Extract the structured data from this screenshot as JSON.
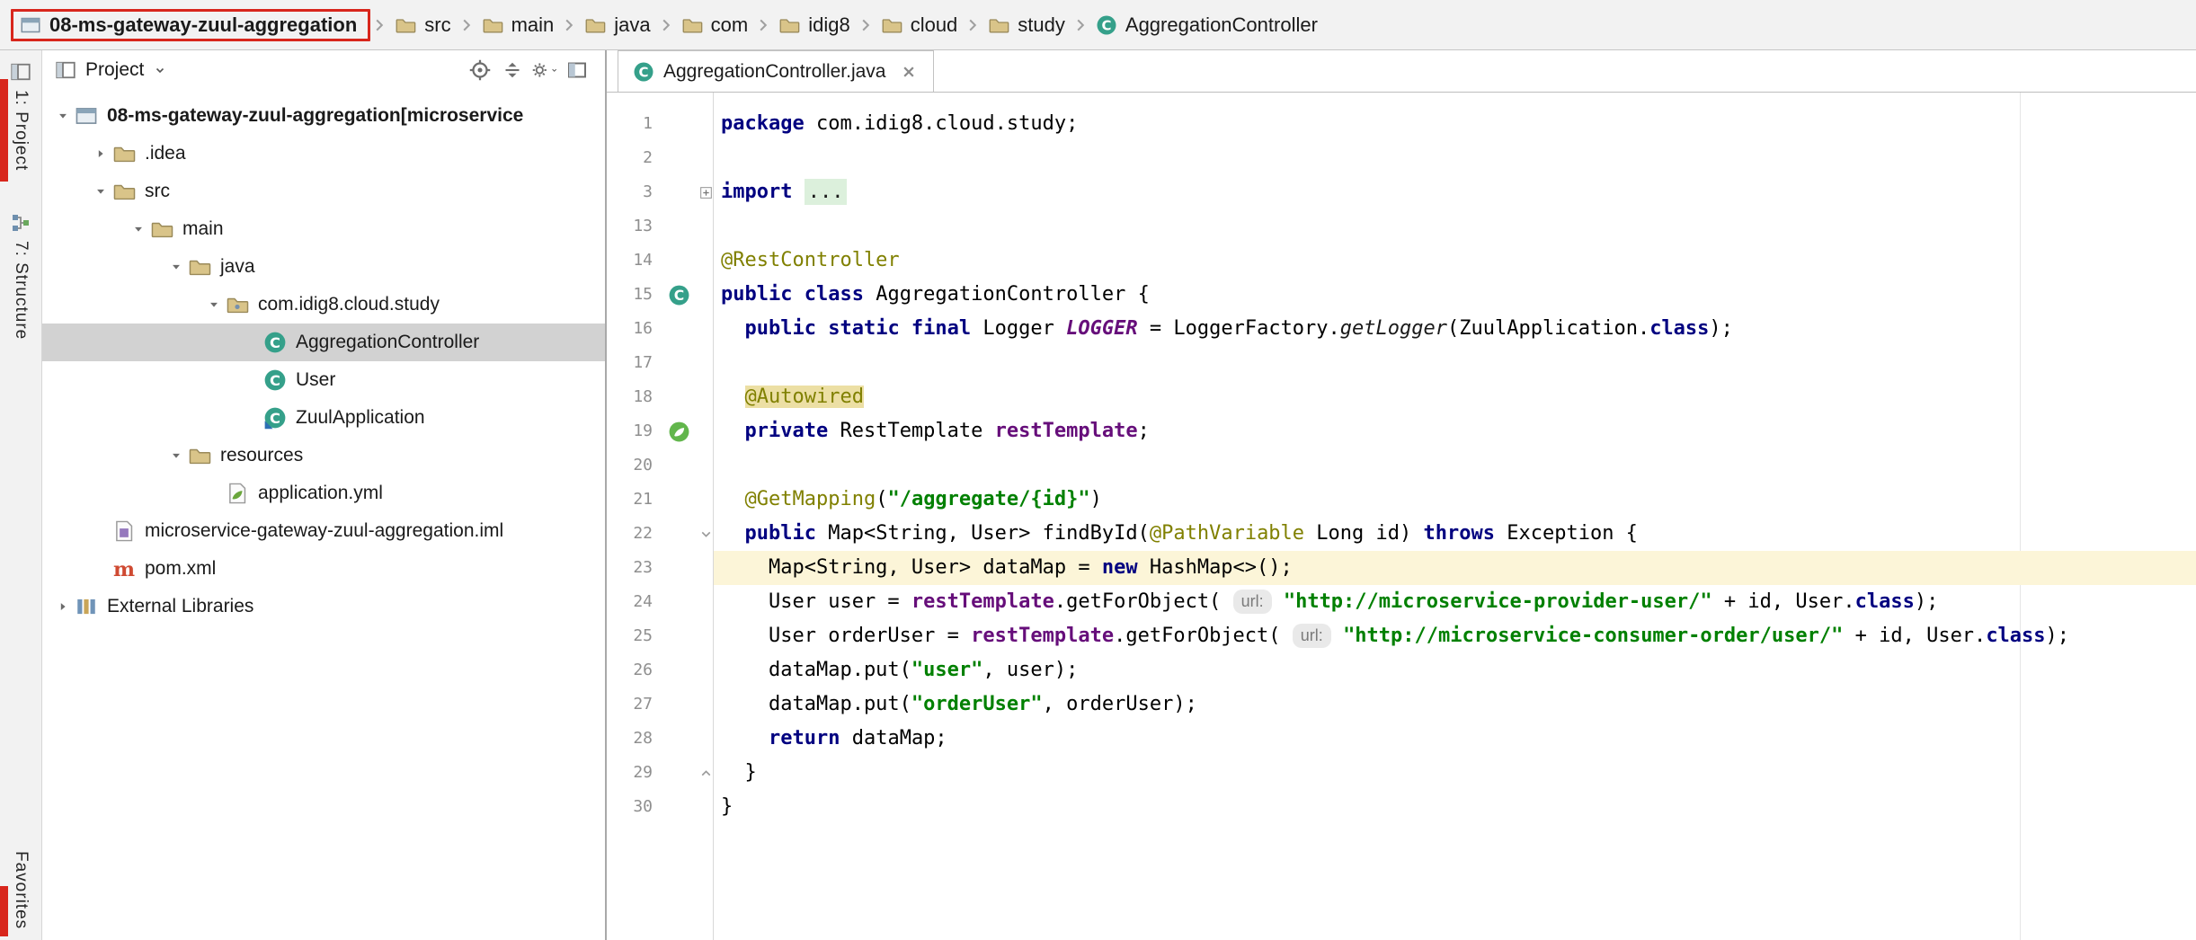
{
  "colors": {
    "annotation_red": "#d8261c",
    "keyword": "#000080",
    "annotation": "#808000",
    "string": "#008000",
    "field_purple": "#660E7A",
    "current_line_bg": "#fcf5d8",
    "usage_highlight_bg": "#ecdfa4",
    "folded_bg": "#dcf0dc",
    "tree_selection_bg": "#d2d2d2",
    "inlay_bg": "#e9e9e9"
  },
  "breadcrumb": {
    "items": [
      {
        "label": "08-ms-gateway-zuul-aggregation",
        "icon": "project-icon",
        "bold": true,
        "annotated": true
      },
      {
        "label": "src",
        "icon": "folder-icon"
      },
      {
        "label": "main",
        "icon": "folder-icon"
      },
      {
        "label": "java",
        "icon": "folder-icon"
      },
      {
        "label": "com",
        "icon": "folder-icon"
      },
      {
        "label": "idig8",
        "icon": "folder-icon"
      },
      {
        "label": "cloud",
        "icon": "folder-icon"
      },
      {
        "label": "study",
        "icon": "folder-icon"
      },
      {
        "label": "AggregationController",
        "icon": "class-icon"
      }
    ]
  },
  "tool_strip": {
    "project_label": "1: Project",
    "structure_label": "7: Structure",
    "favorites_label": "Favorites"
  },
  "project_panel": {
    "title": "Project",
    "header_icons": [
      "locate-icon",
      "collapse-all-icon",
      "settings-gear-icon",
      "hide-panel-icon"
    ],
    "tree": [
      {
        "label": "08-ms-gateway-zuul-aggregation",
        "suffix": " [microservice",
        "icon": "project-icon",
        "depth": 0,
        "chevron": "expanded",
        "bold": true
      },
      {
        "label": ".idea",
        "icon": "folder-icon",
        "depth": 1,
        "chevron": "collapsed"
      },
      {
        "label": "src",
        "icon": "folder-icon",
        "depth": 1,
        "chevron": "expanded"
      },
      {
        "label": "main",
        "icon": "folder-icon",
        "depth": 2,
        "chevron": "expanded"
      },
      {
        "label": "java",
        "icon": "folder-icon",
        "depth": 3,
        "chevron": "expanded"
      },
      {
        "label": "com.idig8.cloud.study",
        "icon": "package-icon",
        "depth": 4,
        "chevron": "expanded"
      },
      {
        "label": "AggregationController",
        "icon": "class-icon",
        "depth": 5,
        "selected": true
      },
      {
        "label": "User",
        "icon": "class-icon",
        "depth": 5
      },
      {
        "label": "ZuulApplication",
        "icon": "main-class-icon",
        "depth": 5
      },
      {
        "label": "resources",
        "icon": "folder-icon",
        "depth": 3,
        "chevron": "expanded"
      },
      {
        "label": "application.yml",
        "icon": "yaml-icon",
        "depth": 4
      },
      {
        "label": "microservice-gateway-zuul-aggregation.iml",
        "icon": "module-file-icon",
        "depth": 1
      },
      {
        "label": "pom.xml",
        "icon": "maven-icon",
        "depth": 1
      },
      {
        "label": "External Libraries",
        "icon": "library-icon",
        "depth": 0,
        "chevron": "collapsed"
      }
    ]
  },
  "editor": {
    "tab_title": "AggregationController.java",
    "lines": [
      {
        "num": "1",
        "tokens": [
          [
            "kw",
            "package"
          ],
          [
            "pl",
            " com.idig8.cloud.study;"
          ]
        ]
      },
      {
        "num": "2",
        "tokens": []
      },
      {
        "num": "3",
        "fold": "plus",
        "tokens": [
          [
            "kw",
            "import"
          ],
          [
            "pl",
            " "
          ],
          [
            "fold",
            "..."
          ]
        ]
      },
      {
        "num": "13",
        "tokens": []
      },
      {
        "num": "14",
        "tokens": [
          [
            "ann",
            "@RestController"
          ]
        ]
      },
      {
        "num": "15",
        "gutter_icon": "class-icon",
        "tokens": [
          [
            "kw",
            "public class"
          ],
          [
            "pl",
            " AggregationController {"
          ]
        ]
      },
      {
        "num": "16",
        "tokens": [
          [
            "pl",
            "  "
          ],
          [
            "kw",
            "public static final"
          ],
          [
            "pl",
            " Logger "
          ],
          [
            "sfld",
            "LOGGER"
          ],
          [
            "pl",
            " = LoggerFactory."
          ],
          [
            "itm",
            "getLogger"
          ],
          [
            "pl",
            "(ZuulApplication."
          ],
          [
            "kw",
            "class"
          ],
          [
            "pl",
            ");"
          ]
        ]
      },
      {
        "num": "17",
        "tokens": []
      },
      {
        "num": "18",
        "tokens": [
          [
            "pl",
            "  "
          ],
          [
            "annhl",
            "@Autowired"
          ]
        ]
      },
      {
        "num": "19",
        "gutter_icon": "spring-bean-icon",
        "tokens": [
          [
            "pl",
            "  "
          ],
          [
            "kw",
            "private"
          ],
          [
            "pl",
            " RestTemplate "
          ],
          [
            "fld",
            "restTemplate"
          ],
          [
            "pl",
            ";"
          ]
        ]
      },
      {
        "num": "20",
        "tokens": []
      },
      {
        "num": "21",
        "tokens": [
          [
            "pl",
            "  "
          ],
          [
            "ann",
            "@GetMapping"
          ],
          [
            "pl",
            "("
          ],
          [
            "str",
            "\"/aggregate/{id}\""
          ],
          [
            "pl",
            ")"
          ]
        ]
      },
      {
        "num": "22",
        "fold": "down",
        "tokens": [
          [
            "pl",
            "  "
          ],
          [
            "kw",
            "public"
          ],
          [
            "pl",
            " Map<String, User> findById("
          ],
          [
            "ann",
            "@PathVariable"
          ],
          [
            "pl",
            " Long id) "
          ],
          [
            "kw",
            "throws"
          ],
          [
            "pl",
            " Exception {"
          ]
        ]
      },
      {
        "num": "23",
        "current": true,
        "tokens": [
          [
            "pl",
            "    Map<String, User> dataMap = "
          ],
          [
            "kw",
            "new"
          ],
          [
            "pl",
            " HashMap<>();"
          ]
        ]
      },
      {
        "num": "24",
        "tokens": [
          [
            "pl",
            "    User user = "
          ],
          [
            "fld",
            "restTemplate"
          ],
          [
            "pl",
            ".getForObject( "
          ],
          [
            "inlay",
            "url:"
          ],
          [
            "pl",
            " "
          ],
          [
            "str",
            "\"http://microservice-provider-user/\""
          ],
          [
            "pl",
            " + id, User."
          ],
          [
            "kw",
            "class"
          ],
          [
            "pl",
            ");"
          ]
        ]
      },
      {
        "num": "25",
        "tokens": [
          [
            "pl",
            "    User orderUser = "
          ],
          [
            "fld",
            "restTemplate"
          ],
          [
            "pl",
            ".getForObject( "
          ],
          [
            "inlay",
            "url:"
          ],
          [
            "pl",
            " "
          ],
          [
            "str",
            "\"http://microservice-consumer-order/user/\""
          ],
          [
            "pl",
            " + id, User."
          ],
          [
            "kw",
            "class"
          ],
          [
            "pl",
            ");"
          ]
        ]
      },
      {
        "num": "26",
        "tokens": [
          [
            "pl",
            "    dataMap.put("
          ],
          [
            "str",
            "\"user\""
          ],
          [
            "pl",
            ", user);"
          ]
        ]
      },
      {
        "num": "27",
        "tokens": [
          [
            "pl",
            "    dataMap.put("
          ],
          [
            "str",
            "\"orderUser\""
          ],
          [
            "pl",
            ", orderUser);"
          ]
        ]
      },
      {
        "num": "28",
        "tokens": [
          [
            "pl",
            "    "
          ],
          [
            "kw",
            "return"
          ],
          [
            "pl",
            " dataMap;"
          ]
        ]
      },
      {
        "num": "29",
        "fold": "up",
        "tokens": [
          [
            "pl",
            "  }"
          ]
        ]
      },
      {
        "num": "30",
        "tokens": [
          [
            "pl",
            "}"
          ]
        ]
      }
    ]
  }
}
